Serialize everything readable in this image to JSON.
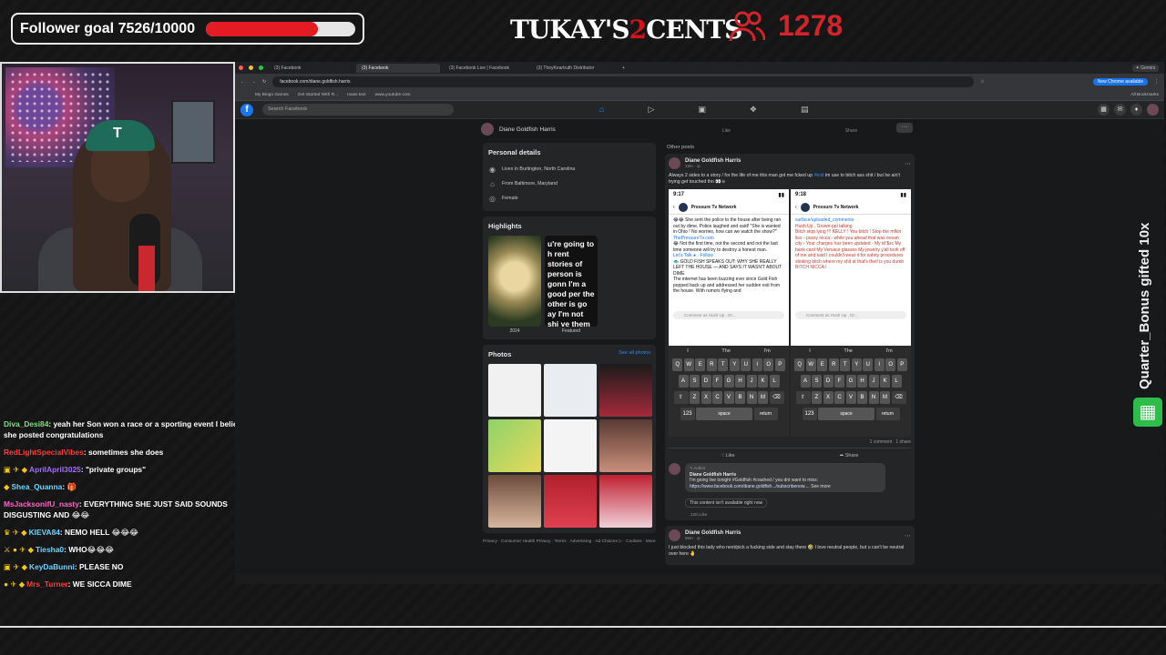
{
  "overlay": {
    "follower_goal": "Follower goal 7526/10000",
    "follower_progress": 0.7526,
    "brand_left": "TUKAY'S",
    "brand_num": "2",
    "brand_right": "CENTS",
    "viewer_count": "1278",
    "side_text": "Quarter_Bonus gifted 10x",
    "accent_red": "#e41b23"
  },
  "cam": {
    "hat_letter": "T"
  },
  "chat": [
    {
      "badges": "",
      "user": "Diva_Desi84",
      "color": "#7ee07e",
      "text": "yeah her Son won a race or a sporting event I believe, and she posted congratulations"
    },
    {
      "badges": "",
      "user": "RedLightSpecialVibes",
      "color": "#ff3b3b",
      "text": "sometimes she does"
    },
    {
      "badges": "▣ ✈ ◆",
      "user": "AprilApril3025",
      "color": "#a46cff",
      "text": "\"private groups\""
    },
    {
      "badges": "◆",
      "user": "Shea_Quanna",
      "color": "#6fd3ff",
      "text": "🎁"
    },
    {
      "badges": "",
      "user": "MsJacksonifU_nasty",
      "color": "#ff63c8",
      "text": "EVERYTHING SHE JUST SAID SOUNDS DISGUSTING AND 😂😂"
    },
    {
      "badges": "♛ ✈ ◆",
      "user": "KIEVA84",
      "color": "#6fd3ff",
      "text": "NEMO HELL 😂😂😂"
    },
    {
      "badges": "⚔ ● ✈ ◆",
      "user": "Tiesha0",
      "color": "#6fd3ff",
      "text": "WHO😂😂😂"
    },
    {
      "badges": "▣ ✈ ◆",
      "user": "KeyDaBunni",
      "color": "#6fd3ff",
      "text": "PLEASE NO"
    },
    {
      "badges": "● ✈ ◆",
      "user": "Mrs_Turner",
      "color": "#ff3b3b",
      "text": "WE SICCA DIME"
    }
  ],
  "browser": {
    "tabs": [
      {
        "label": "(3) Facebook",
        "active": false
      },
      {
        "label": "(3) Facebook",
        "active": true
      },
      {
        "label": "(3) Facebook Live | Facebook",
        "active": false
      },
      {
        "label": "(3) TheyKeartruth Distributor",
        "active": false
      }
    ],
    "tab_plus": "+",
    "gemini": "✦ Gemini",
    "url": "facebook.com/diane.goldfish.harris",
    "update_label": "New Chrome available",
    "bookmarks": [
      "My Bingo Games",
      "Get Started With R...",
      "mass text",
      "www.youtube.com"
    ],
    "all_bookmarks": "All Bookmarks"
  },
  "fb": {
    "logo": "f",
    "search_placeholder": "Search Facebook",
    "profile_name": "Diane Goldfish Harris",
    "more_label": "···",
    "personal_details_title": "Personal details",
    "details": [
      {
        "icon": "location-icon",
        "glyph": "◉",
        "text": "Lives in Burlington, North Carolina"
      },
      {
        "icon": "home-icon",
        "glyph": "⌂",
        "text": "From Baltimore, Maryland"
      },
      {
        "icon": "gender-icon",
        "glyph": "◎",
        "text": "Female"
      }
    ],
    "highlights_title": "Highlights",
    "highlights": [
      {
        "caption": "2024",
        "text": ""
      },
      {
        "caption": "Featured",
        "text": "u're going to h rent stories of person is gonn I'm a good per the other is go ay I'm not shi ve them both, accordingly."
      }
    ],
    "photos_title": "Photos",
    "see_all": "See all photos",
    "footer": "Privacy · Consumer Health Privacy · Terms · Advertising · Ad Choices ▷ · Cookies · More",
    "prev_actions": [
      "Like",
      "Share"
    ],
    "other_posts": "Other posts",
    "post1": {
      "author": "Diane Goldfish Harris",
      "time": "12m · ◎",
      "text_a": "Always 2 sides to a story / for the life of me this man got me f",
      "text_b": "cked up ",
      "tag": "#kotl",
      "text_c": " im use to bitch ass shit / but he ain't trying get touched tho 👀☠",
      "shot1": {
        "time": "9:17",
        "title": "Pressure Tv Network",
        "body_1": "😂😂 She sent the police to the house after being ran out by dime. Police laughed and said! \"She is wanted in Ohio ! No worries, how can we watch the show?\"",
        "link": "ThePressureTv.com",
        "body_2": "😂 Not the first time, not the second and not the last time someone will try to destroy a honest man.",
        "body_3": "Let's Talk ● · Follow",
        "body_4": "🐟 GOLD FISH SPEAKS OUT: WHY SHE REALLY LEFT THE HOUSE — AND SAYS IT WASN'T ABOUT DIME",
        "body_5": "The internet has been buzzing ever since Gold Fish popped back up and addressed her sudden exit from the house. With rumors flying and",
        "input": "Comment as Hush Up , Gr..."
      },
      "shot2": {
        "time": "9:18",
        "title": "Pressure Tv Network",
        "link": "surface/uploaded_comments",
        "body_1": "Hush Up , Grown-ppl talking",
        "body_2": "Bitch stop lying !!! KELLY ! You bitch ! Stop the mfkin lies - pussy nicca - while you ahead that was ocean city - Your charges has been updated - My id $sc My bank card My Versace glasses My jewelry y'all took off of me and said I couldn't wear it for safety procedures stinking bitch where my shit at that's theif is you dumb BITCH NICCA !",
        "input": "Comment as Hush Up , Gr..."
      },
      "kb_suggestions": [
        "I",
        "The",
        "I'm"
      ],
      "kb_row1": [
        "Q",
        "W",
        "E",
        "R",
        "T",
        "Y",
        "U",
        "I",
        "O",
        "P"
      ],
      "kb_row2": [
        "A",
        "S",
        "D",
        "F",
        "G",
        "H",
        "J",
        "K",
        "L"
      ],
      "kb_row3": [
        "⇧",
        "Z",
        "X",
        "C",
        "V",
        "B",
        "N",
        "M",
        "⌫"
      ],
      "kb_num": "123",
      "kb_space": "space",
      "kb_return": "return",
      "meta_comments": "1 comment",
      "meta_shares": "1 share",
      "like": "Like",
      "share": "Share",
      "comment_badge": "✎ Author",
      "comment_name": "Diane Goldfish Harris",
      "comment_text": "I'm going live tonight #Goldfish #crashed / you dnt want to miss:",
      "comment_link": "https://www.facebook.com/diane.goldfish.../subscribenow....",
      "see_more": "See more",
      "unavailable": "This content isn't available right now",
      "comment_meta": "12m   Like"
    },
    "post2": {
      "author": "Diane Goldfish Harris",
      "time": "55m · ◎",
      "text": "I just blocked this lady who next/pick a fucking side and stay there 🤣 I love neutral people, but u can't be neutral over here 🤚"
    }
  }
}
